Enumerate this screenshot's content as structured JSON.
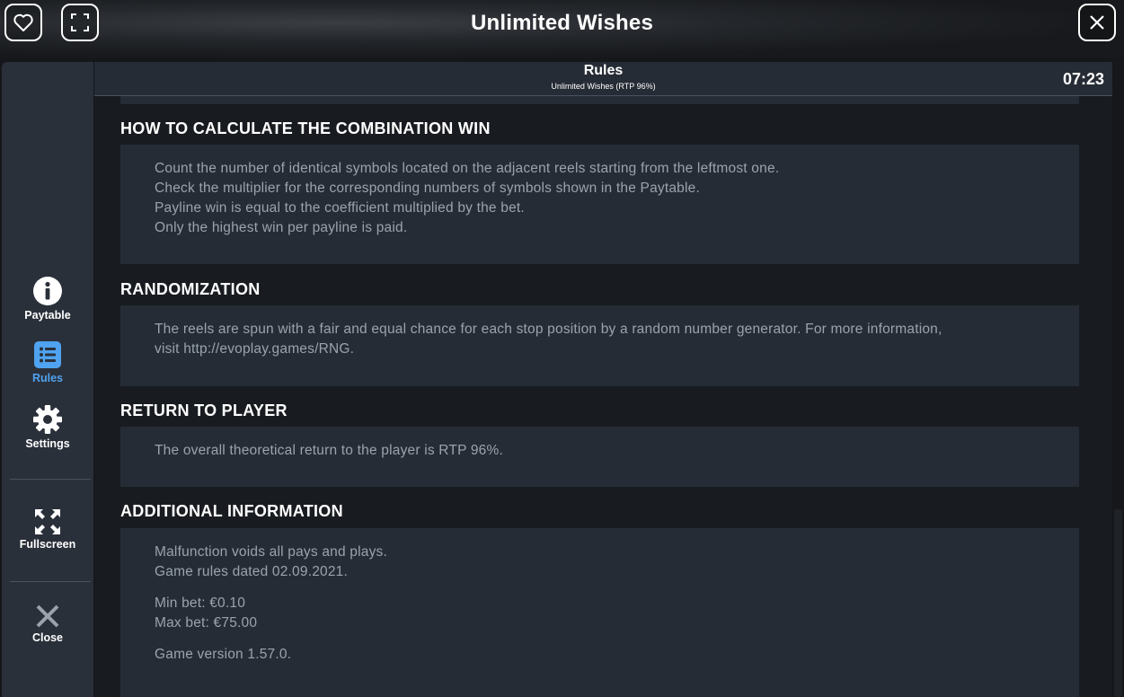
{
  "window": {
    "title": "Unlimited Wishes",
    "favorite_icon": "heart-icon",
    "fullscreen_icon": "fullscreen-icon",
    "close_icon": "close-icon"
  },
  "sidebar": {
    "items": [
      {
        "label": "Paytable",
        "icon": "info-icon",
        "active": false
      },
      {
        "label": "Rules",
        "icon": "list-icon",
        "active": true
      },
      {
        "label": "Settings",
        "icon": "gear-icon",
        "active": false
      },
      {
        "label": "Fullscreen",
        "icon": "expand-icon",
        "active": false
      },
      {
        "label": "Close",
        "icon": "close-icon",
        "active": false
      }
    ]
  },
  "header": {
    "title": "Rules",
    "subtitle": "Unlimited Wishes (RTP 96%)",
    "clock": "07:23"
  },
  "sections": [
    {
      "title": "HOW TO CALCULATE THE COMBINATION WIN",
      "lines": [
        "Count the number of identical symbols located on the adjacent reels starting from the leftmost one.",
        "Check the multiplier for the corresponding numbers of symbols shown in the Paytable.",
        "Payline win is equal to the coefficient multiplied by the bet.",
        "Only the highest win per payline is paid."
      ]
    },
    {
      "title": "RANDOMIZATION",
      "lines": [
        "The reels are spun with a fair and equal chance for each stop position by a random number generator. For more information,",
        "visit http://evoplay.games/RNG."
      ]
    },
    {
      "title": "RETURN TO PLAYER",
      "lines": [
        "The overall theoretical return to the player is RTP 96%."
      ]
    },
    {
      "title": "ADDITIONAL INFORMATION",
      "lines": [
        "Malfunction voids all pays and plays.",
        "Game rules dated 02.09.2021.",
        "Min bet: €0.10",
        "Max bet: €75.00",
        "Game version 1.57.0."
      ]
    }
  ],
  "colors": {
    "accent": "#4fa3f0",
    "panel": "#262c35",
    "sidebar": "#2a303a",
    "body_text": "#9aa3ad"
  }
}
